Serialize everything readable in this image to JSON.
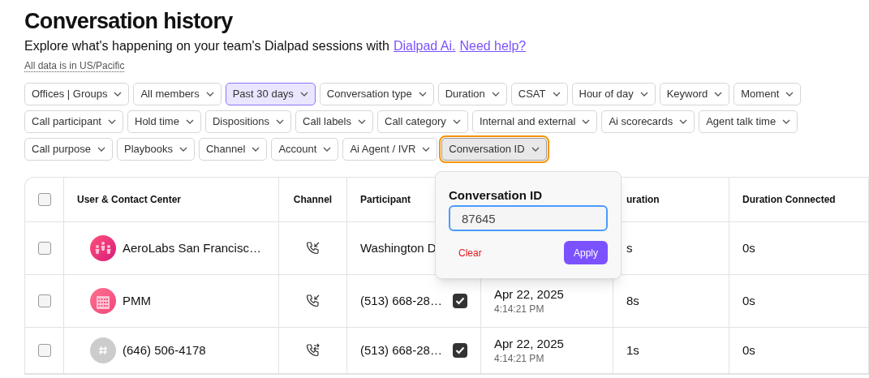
{
  "header": {
    "title": "Conversation history",
    "subtitle": "Explore what's happening on your team's Dialpad sessions with",
    "links": [
      "Dialpad Ai.",
      "Need help?"
    ],
    "timezone_note": "All data is in US/Pacific"
  },
  "filter_rows": [
    [
      {
        "label": "Offices | Groups",
        "applied": false,
        "open": false
      },
      {
        "label": "All members",
        "applied": false,
        "open": false
      },
      {
        "label": "Past 30 days",
        "applied": true,
        "open": false
      },
      {
        "label": "Conversation type",
        "applied": false,
        "open": false
      },
      {
        "label": "Duration",
        "applied": false,
        "open": false
      },
      {
        "label": "CSAT",
        "applied": false,
        "open": false
      },
      {
        "label": "Hour of day",
        "applied": false,
        "open": false
      },
      {
        "label": "Keyword",
        "applied": false,
        "open": false
      },
      {
        "label": "Moment",
        "applied": false,
        "open": false
      }
    ],
    [
      {
        "label": "Call participant",
        "applied": false,
        "open": false
      },
      {
        "label": "Hold time",
        "applied": false,
        "open": false
      },
      {
        "label": "Dispositions",
        "applied": false,
        "open": false
      },
      {
        "label": "Call labels",
        "applied": false,
        "open": false
      },
      {
        "label": "Call category",
        "applied": false,
        "open": false
      },
      {
        "label": "Internal and external",
        "applied": false,
        "open": false
      },
      {
        "label": "Ai scorecards",
        "applied": false,
        "open": false
      },
      {
        "label": "Agent talk time",
        "applied": false,
        "open": false
      }
    ],
    [
      {
        "label": "Call purpose",
        "applied": false,
        "open": false
      },
      {
        "label": "Playbooks",
        "applied": false,
        "open": false
      },
      {
        "label": "Channel",
        "applied": false,
        "open": false
      },
      {
        "label": "Account",
        "applied": false,
        "open": false
      },
      {
        "label": "Ai Agent / IVR",
        "applied": false,
        "open": false
      },
      {
        "label": "Conversation ID",
        "applied": false,
        "open": true
      }
    ]
  ],
  "popover": {
    "title": "Conversation ID",
    "value": "87645",
    "clear": "Clear",
    "apply": "Apply"
  },
  "table": {
    "select_all": {
      "checked": false
    },
    "columns": [
      "User & Contact Center",
      "Channel",
      "Participant",
      "uration",
      "Duration Connected"
    ],
    "rows": [
      {
        "checked": false,
        "avatar": {
          "kind": "group"
        },
        "name": "AeroLabs San Francisc…",
        "channel": {
          "kind": "inbound"
        },
        "participant": "Washington D",
        "duration": "s",
        "duration_connected": "0s"
      },
      {
        "checked": false,
        "avatar": {
          "kind": "building"
        },
        "name": "PMM",
        "channel": {
          "kind": "inbound"
        },
        "participant": "(513) 668-28…",
        "participant_checked": true,
        "date": "Apr 22, 2025",
        "time": "4:14:21 PM",
        "duration": "8s",
        "duration_connected": "0s"
      },
      {
        "checked": false,
        "avatar": {
          "kind": "number"
        },
        "name": "(646) 506-4178",
        "channel": {
          "kind": "transfer"
        },
        "participant": "(513) 668-28…",
        "participant_checked": true,
        "date": "Apr 22, 2025",
        "time": "4:14:21 PM",
        "duration": "1s",
        "duration_connected": "0s"
      }
    ]
  }
}
